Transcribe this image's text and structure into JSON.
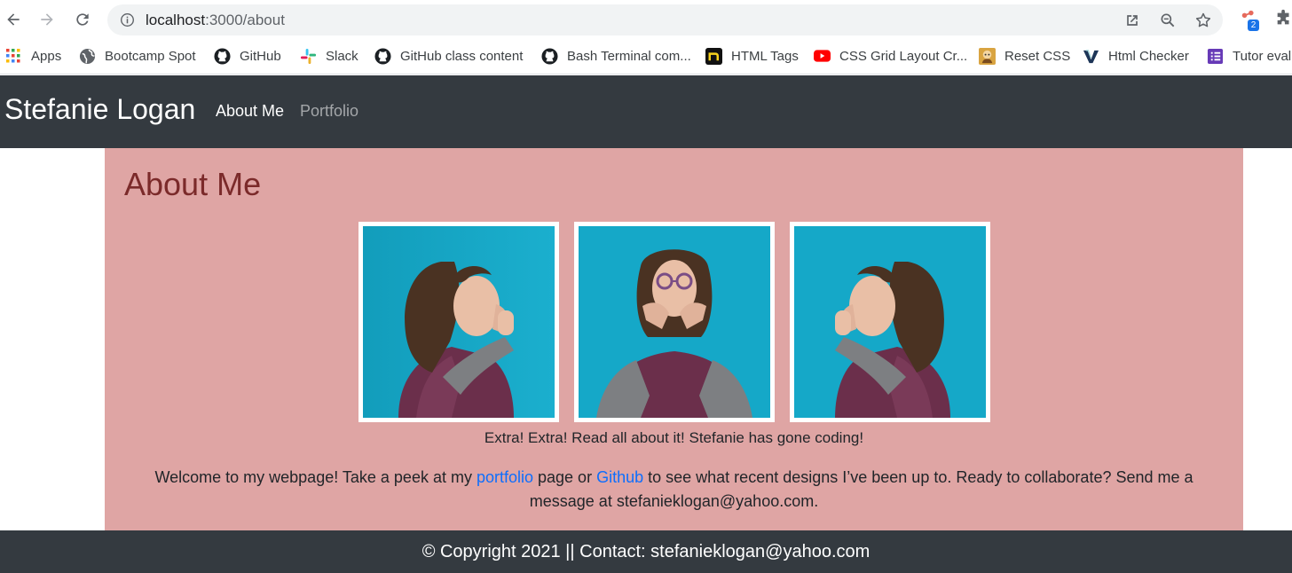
{
  "browser": {
    "url_host": "localhost",
    "url_path": ":3000/about",
    "extension_badge": "2"
  },
  "bookmarks": [
    {
      "label": "Apps",
      "icon": "apps-grid-icon"
    },
    {
      "label": "Bootcamp Spot",
      "icon": "globe-icon"
    },
    {
      "label": "GitHub",
      "icon": "github-icon"
    },
    {
      "label": "Slack",
      "icon": "slack-icon"
    },
    {
      "label": "GitHub class content",
      "icon": "github-icon"
    },
    {
      "label": "Bash Terminal com...",
      "icon": "github-icon"
    },
    {
      "label": "HTML Tags",
      "icon": "n-logo-icon"
    },
    {
      "label": "CSS Grid Layout Cr...",
      "icon": "youtube-icon"
    },
    {
      "label": "Reset CSS",
      "icon": "reset-css-icon"
    },
    {
      "label": "Html Checker",
      "icon": "validator-icon"
    },
    {
      "label": "Tutor eval",
      "icon": "forms-icon"
    }
  ],
  "site_nav": {
    "brand": "Stefanie Logan",
    "links": [
      {
        "label": "About Me",
        "active": true
      },
      {
        "label": "Portfolio",
        "active": false
      }
    ]
  },
  "about": {
    "heading": "About Me",
    "caption": "Extra! Extra! Read all about it! Stefanie has gone coding!",
    "welcome_before": "Welcome to my webpage! Take a peek at my ",
    "portfolio_link": "portfolio",
    "welcome_middle": " page or ",
    "github_link": "Github",
    "welcome_after": " to see what recent designs I’ve been up to. Ready to collaborate? Send me a message at stefanieklogan@yahoo.com."
  },
  "footer": {
    "text": "© Copyright 2021 || Contact: stefanieklogan@yahoo.com"
  },
  "colors": {
    "navbar": "#343a40",
    "content_bg": "#dfa5a4",
    "heading": "#7b2a2a",
    "link": "#0d6efd",
    "photo_bg": "#15a8c8"
  }
}
